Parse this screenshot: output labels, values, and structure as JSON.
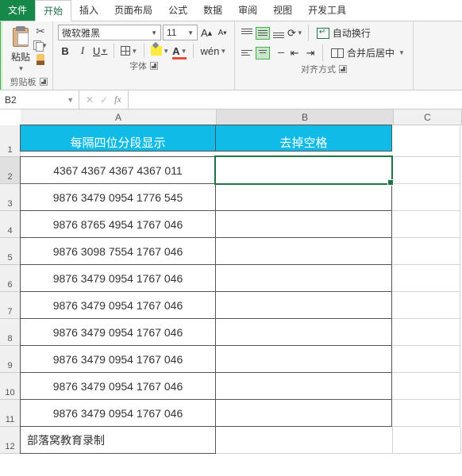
{
  "tabs": {
    "file": "文件",
    "home": "开始",
    "insert": "插入",
    "layout": "页面布局",
    "formula": "公式",
    "data": "数据",
    "review": "审阅",
    "view": "视图",
    "dev": "开发工具"
  },
  "ribbon": {
    "paste": "粘贴",
    "clipboard_label": "剪贴板",
    "font_name": "微软雅黑",
    "font_size": "11",
    "font_label": "字体",
    "wen": "wén",
    "wrap": "自动换行",
    "merge": "合并后居中",
    "align_label": "对齐方式"
  },
  "namebox": "B2",
  "headers": {
    "A": "每隔四位分段显示",
    "B": "去掉空格"
  },
  "rows": [
    "4367 4367 4367 4367 011",
    "9876 3479 0954 1776 545",
    "9876 8765 4954 1767 046",
    "9876 3098 7554 1767 046",
    "9876 3479 0954 1767 046",
    "9876 3479 0954 1767 046",
    "9876 3479 0954 1767 046",
    "9876 3479 0954 1767 046",
    "9876 3479 0954 1767 046",
    "9876 3479 0954 1767 046"
  ],
  "footer": "部落窝教育录制",
  "cols": {
    "A": "A",
    "B": "B",
    "C": "C"
  },
  "rownums": [
    "1",
    "2",
    "3",
    "4",
    "5",
    "6",
    "7",
    "8",
    "9",
    "10",
    "11",
    "12"
  ]
}
